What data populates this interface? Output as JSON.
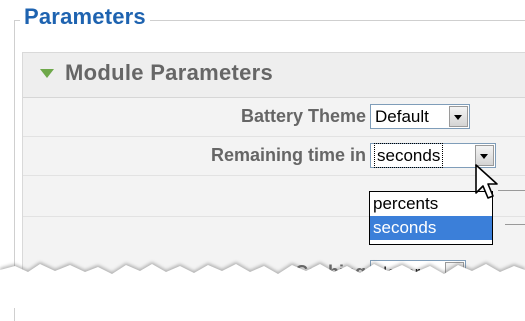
{
  "fieldset": {
    "legend": "Parameters"
  },
  "module": {
    "title": "Module Parameters"
  },
  "rows": [
    {
      "label": "Battery Theme",
      "value": "Default"
    },
    {
      "label": "Remaining time in",
      "value": "seconds"
    },
    {
      "label": "",
      "value": ""
    },
    {
      "label": "Caching",
      "value": "Never"
    }
  ],
  "dropdown": {
    "options": [
      "percents",
      "seconds"
    ],
    "selected": "seconds"
  },
  "icons": {
    "section_toggle": "triangle-down-icon",
    "select_arrow": "chevron-down-icon",
    "pointer": "mouse-cursor-icon"
  },
  "colors": {
    "legend": "#1e63b0",
    "toggle": "#6ea84a",
    "selected_option": "#3b7fd9"
  }
}
